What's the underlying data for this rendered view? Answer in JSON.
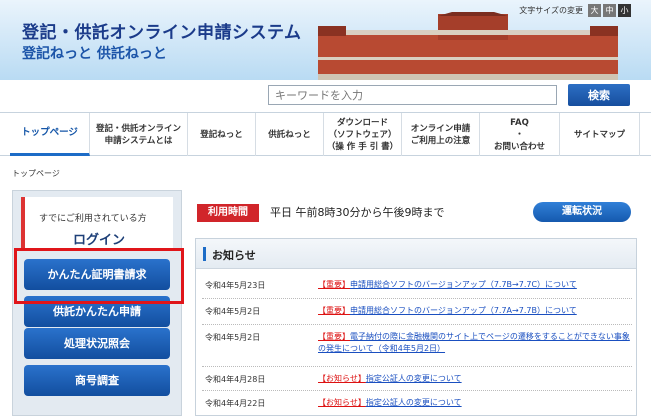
{
  "header": {
    "title": "登記・供託オンライン申請システム",
    "subtitle": "登記ねっと 供託ねっと",
    "font_size_label": "文字サイズの変更",
    "font_sizes": [
      "大",
      "中",
      "小"
    ]
  },
  "search": {
    "placeholder": "キーワードを入力",
    "button_label": "検索"
  },
  "nav": {
    "items": [
      "トップページ",
      "登記・供託オンライン\n申請システムとは",
      "登記ねっと",
      "供託ねっと",
      "ダウンロード\n（ソフトウェア）\n（操 作 手 引 書）",
      "オンライン申請\nご利用上の注意",
      "FAQ\n・\nお問い合わせ",
      "サイトマップ"
    ]
  },
  "breadcrumb": "トップページ",
  "sidebar": {
    "login_caption": "すでにご利用されている方",
    "login_title": "ログイン",
    "buttons": [
      "かんたん証明書請求",
      "供託かんたん申請",
      "処理状況照会",
      "商号調査"
    ]
  },
  "hours": {
    "badge": "利用時間",
    "text": "平日 午前8時30分から午後9時まで",
    "status_button": "運転状況"
  },
  "news": {
    "title": "お知らせ",
    "items": [
      {
        "date": "令和4年5月23日",
        "tag": "【重要】",
        "text": "申請用総合ソフトのバージョンアップ（7.7B→7.7C）について"
      },
      {
        "date": "令和4年5月2日",
        "tag": "【重要】",
        "text": "申請用総合ソフトのバージョンアップ（7.7A→7.7B）について"
      },
      {
        "date": "令和4年5月2日",
        "tag": "【重要】",
        "text": "電子納付の際に金融機関のサイト上でページの遷移をすることができない事象の発生について（令和4年5月2日）"
      },
      {
        "date": "令和4年4月28日",
        "tag": "【お知らせ】",
        "text": "指定公証人の変更について"
      },
      {
        "date": "令和4年4月22日",
        "tag": "【お知らせ】",
        "text": "指定公証人の変更について"
      }
    ]
  },
  "colors": {
    "brand_blue": "#1556a8",
    "alert_red": "#d1252a"
  }
}
